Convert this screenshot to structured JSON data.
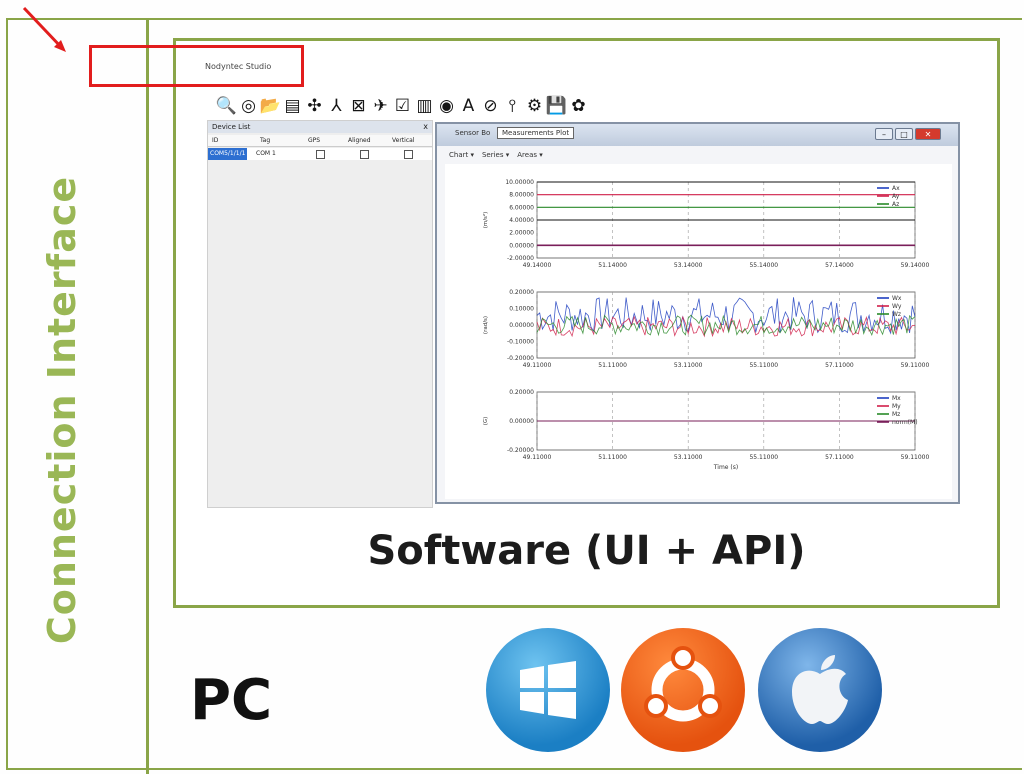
{
  "slide": {
    "side_label": "Connection Interface",
    "caption": "Software (UI + API)",
    "pc_label": "PC"
  },
  "app": {
    "title": "Nodyntec Studio",
    "toolbar_icons": [
      "search-icon",
      "target-icon",
      "folder-icon",
      "chip-icon",
      "network-icon",
      "axes-icon",
      "image-icon",
      "plane-icon",
      "checkbox-icon",
      "chart-icon",
      "globe-icon",
      "letter-a-icon",
      "compass-icon",
      "pin-icon",
      "gear-icon",
      "save-icon",
      "brain-icon"
    ],
    "toolbar_glyphs": [
      "🔍",
      "◎",
      "📂",
      "▤",
      "✣",
      "⅄",
      "⊠",
      "✈",
      "☑",
      "▥",
      "◉",
      "A",
      "⊘",
      "⫯",
      "⚙",
      "💾",
      "✿"
    ]
  },
  "device_panel": {
    "title": "Device List",
    "close": "x",
    "columns": [
      "ID",
      "Tag",
      "GPS",
      "Aligned",
      "Vertical"
    ],
    "row": {
      "id": "COM5/1/1/1",
      "tag": "COM 1"
    }
  },
  "plot_window": {
    "title": "Sensor Bo",
    "tooltip": "Measurements Plot",
    "menu": [
      "Chart ▾",
      "Series ▾",
      "Areas ▾"
    ],
    "buttons": {
      "min": "–",
      "max": "□",
      "close": "✕"
    },
    "colors": {
      "blue": "#1f3fbf",
      "red": "#d0204a",
      "green": "#2a8a2a",
      "purple": "#7a1f5a",
      "black": "#111111"
    }
  },
  "chart_data": [
    {
      "type": "line",
      "ylabel": "(m/s²)",
      "yticks": [
        "10.00000",
        "8.00000",
        "6.00000",
        "4.00000",
        "2.00000",
        "0.00000",
        "-2.00000"
      ],
      "ylim": [
        -2,
        10
      ],
      "xticks": [
        "49.14000",
        "51.14000",
        "53.14000",
        "55.14000",
        "57.14000",
        "59.14000"
      ],
      "xlim": [
        49.14,
        59.14
      ],
      "legend_position": "top-right",
      "series": [
        {
          "name": "Ax",
          "color": "#1f3fbf",
          "values": [
            10.0,
            10.0
          ]
        },
        {
          "name": "Ay",
          "color": "#d0204a",
          "values": [
            8.0,
            8.0
          ]
        },
        {
          "name": "Az",
          "color": "#2a8a2a",
          "values": [
            6.0,
            6.0
          ]
        }
      ]
    },
    {
      "type": "line",
      "ylabel": "(rad/s)",
      "yticks": [
        "0.20000",
        "0.10000",
        "0.00000",
        "-0.10000",
        "-0.20000"
      ],
      "ylim": [
        -0.2,
        0.2
      ],
      "xticks": [
        "49.11000",
        "51.11000",
        "53.11000",
        "55.11000",
        "57.11000",
        "59.11000"
      ],
      "xlim": [
        49.11,
        59.11
      ],
      "legend_position": "top-right",
      "series": [
        {
          "name": "Wx",
          "color": "#1f3fbf"
        },
        {
          "name": "Wy",
          "color": "#d0204a"
        },
        {
          "name": "Wz",
          "color": "#2a8a2a"
        }
      ]
    },
    {
      "type": "line",
      "ylabel": "(G)",
      "yticks": [
        "0.20000",
        "0.00000",
        "-0.20000"
      ],
      "ylim": [
        -0.2,
        0.2
      ],
      "xticks": [
        "49.11000",
        "51.11000",
        "53.11000",
        "55.11000",
        "57.11000",
        "59.11000"
      ],
      "xlim": [
        49.11,
        59.11
      ],
      "xlabel": "Time (s)",
      "legend_position": "top-right",
      "series": [
        {
          "name": "Mx",
          "color": "#1f3fbf",
          "values": [
            0,
            0
          ]
        },
        {
          "name": "My",
          "color": "#d0204a",
          "values": [
            0,
            0
          ]
        },
        {
          "name": "Mz",
          "color": "#2a8a2a",
          "values": [
            0,
            0
          ]
        },
        {
          "name": "norm(M)",
          "color": "#7a1f5a",
          "values": [
            0,
            0
          ]
        }
      ]
    }
  ],
  "os_logos": [
    "windows-logo",
    "ubuntu-logo",
    "apple-logo"
  ]
}
